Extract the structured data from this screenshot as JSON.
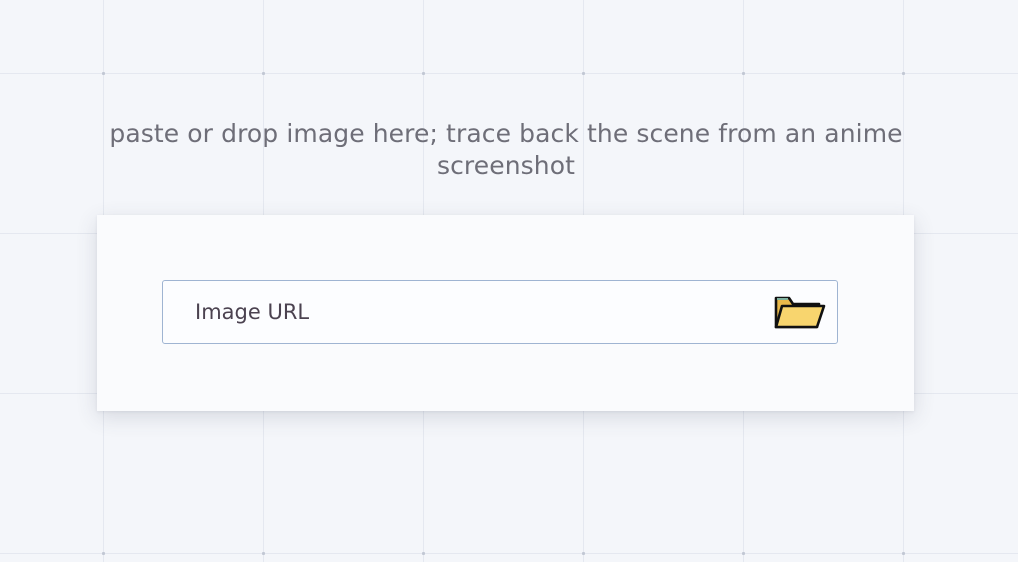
{
  "page": {
    "instruction": "paste or drop image here; trace back the scene from an anime screenshot"
  },
  "search": {
    "url_placeholder": "Image URL",
    "url_value": "",
    "browse_icon": "folder-icon"
  },
  "colors": {
    "background": "#f4f6fa",
    "card": "#fafbfd",
    "field_border": "#9fb4d2",
    "folder_fill": "#f8d56e",
    "instruction_text": "#6e6e78"
  }
}
